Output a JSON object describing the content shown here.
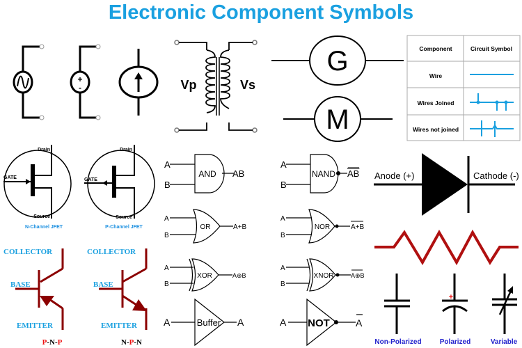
{
  "title": "Electronic Component Symbols",
  "colors": {
    "title": "#1aa0e0",
    "wire_blue": "#1aa0e0",
    "transistor": "#8b0000",
    "resistor": "#b01010",
    "label_blue": "#1a8fe0",
    "capacitor_label": "#2222cc",
    "polarity_red": "#ee1111"
  },
  "sources": {
    "ac_source": {
      "symbol": "sine-wave"
    },
    "dc_source": {
      "plus": "+",
      "minus": "-"
    },
    "current_source": {
      "symbol": "up-arrow"
    }
  },
  "transformer": {
    "primary": "Vp",
    "secondary": "Vs"
  },
  "generator": {
    "label": "G"
  },
  "motor": {
    "label": "M"
  },
  "wire_table": {
    "headers": [
      "Component",
      "Circuit Symbol"
    ],
    "rows": [
      {
        "component": "Wire",
        "symbol": "wire"
      },
      {
        "component": "Wires Joined",
        "symbol": "wires-joined"
      },
      {
        "component": "Wires not joined",
        "symbol": "wires-not-joined"
      }
    ]
  },
  "jfets": [
    {
      "drain": "Drain",
      "gate": "GATE",
      "source": "Source",
      "caption": "N-Channel JFET"
    },
    {
      "drain": "Drain",
      "gate": "GATE",
      "source": "Source",
      "caption": "P-Channel JFET"
    }
  ],
  "transistors": [
    {
      "collector": "COLLECTOR",
      "base": "BASE",
      "emitter": "EMITTER",
      "type": [
        "P",
        "N",
        "P"
      ]
    },
    {
      "collector": "COLLECTOR",
      "base": "BASE",
      "emitter": "EMITTER",
      "type": [
        "N",
        "P",
        "N"
      ]
    }
  ],
  "gates": {
    "and": {
      "label": "AND",
      "in_a": "A",
      "in_b": "B",
      "out": "AB"
    },
    "or": {
      "label": "OR",
      "in_a": "A",
      "in_b": "B",
      "out": "A+B"
    },
    "xor": {
      "label": "XOR",
      "in_a": "A",
      "in_b": "B",
      "out": "A⊕B"
    },
    "buffer": {
      "label": "Buffer",
      "in_a": "A",
      "out": "A"
    },
    "nand": {
      "label": "NAND",
      "in_a": "A",
      "in_b": "B",
      "out": "AB"
    },
    "nor": {
      "label": "NOR",
      "in_a": "A",
      "in_b": "B",
      "out": "A+B"
    },
    "xnor": {
      "label": "XNOR",
      "in_a": "A",
      "in_b": "B",
      "out": "A⊕B"
    },
    "not": {
      "label": "NOT",
      "in_a": "A",
      "out": "A"
    }
  },
  "diode": {
    "anode": "Anode (+)",
    "cathode": "Cathode (-)"
  },
  "capacitors": {
    "non_polarized": "Non-Polarized",
    "polarized": "Polarized",
    "polarized_sign": "+",
    "variable": "Variable"
  }
}
